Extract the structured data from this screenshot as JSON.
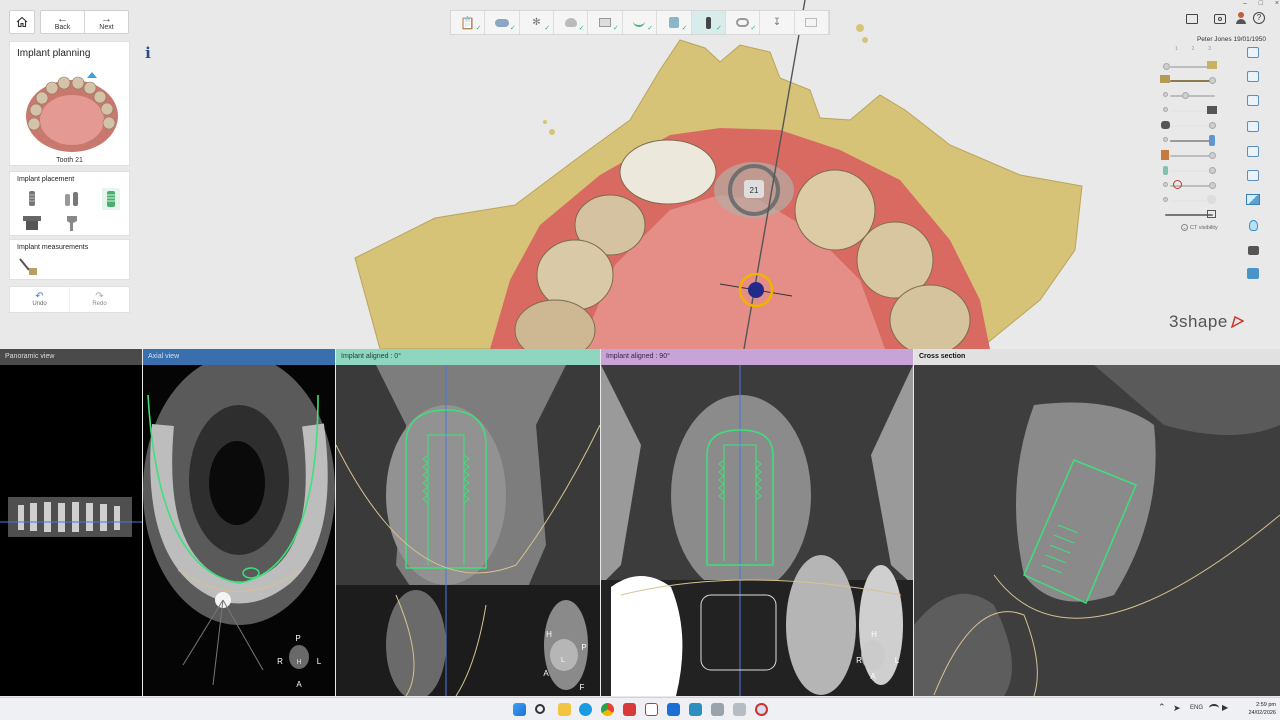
{
  "nav": {
    "back_label": "Back",
    "next_label": "Next"
  },
  "left": {
    "panel_title": "Implant planning",
    "info_label": "i",
    "tooth_label": "Tooth 21",
    "placement_title": "Implant placement",
    "measurements_title": "Implant measurements",
    "undo_label": "Undo",
    "redo_label": "Redo"
  },
  "viewport": {
    "tooth_marker": "21"
  },
  "patient": {
    "name_date": "Peter Jones 19/01/1950",
    "layer_numbers": [
      "1",
      "2",
      "3"
    ]
  },
  "right_tools": {
    "ct_visibility_label": "CT visibility"
  },
  "brand": {
    "logo_text": "3shape"
  },
  "views": {
    "panoramic": "Panoramic view",
    "axial": "Axial view",
    "aligned0": "Implant aligned : 0°",
    "aligned90": "Implant aligned : 90°",
    "cross": "Cross section"
  },
  "orientation": {
    "axial": {
      "top": "P",
      "left": "R",
      "right": "L",
      "bottom": "A",
      "mid": "H"
    },
    "aligned0": {
      "top": "H",
      "right": "P",
      "left": "A",
      "bottom": "F",
      "mid": "L"
    },
    "aligned90": {
      "top": "H",
      "left": "R",
      "right": "L",
      "bottom": "A",
      "mid": ""
    }
  },
  "taskbar": {
    "language": "ENG",
    "time": "2:59 pm",
    "date": "24/02/2026"
  },
  "colors": {
    "panoramic_header": "#4a4a4a",
    "axial_header": "#3a6fae",
    "aligned0_header": "#8fd6c0",
    "aligned90_header": "#c7a3d8",
    "cross_header": "#e1e1e1",
    "implant_outline": "#3ee07a",
    "nerve_line": "#d8c290",
    "axis_line": "#4a78d8"
  }
}
